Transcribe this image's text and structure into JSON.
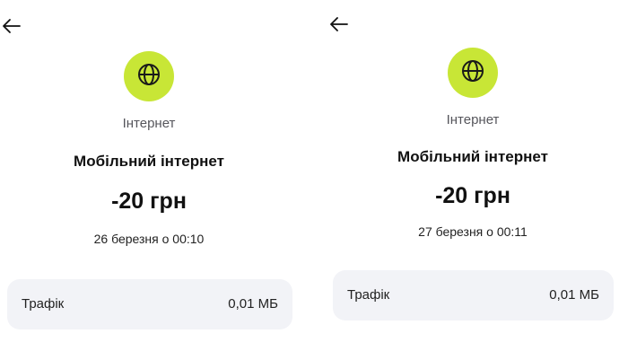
{
  "screens": [
    {
      "back_icon": "arrow-left-icon",
      "category_icon": "globe-icon",
      "category_color": "#c8e636",
      "category_label": "Інтернет",
      "title": "Мобільний інтернет",
      "amount": "-20 грн",
      "date": "26 березня о 00:10",
      "detail": {
        "label": "Трафік",
        "value": "0,01 МБ"
      }
    },
    {
      "back_icon": "arrow-left-icon",
      "category_icon": "globe-icon",
      "category_color": "#c8e636",
      "category_label": "Інтернет",
      "title": "Мобільний інтернет",
      "amount": "-20 грн",
      "date": "27 березня о 00:11",
      "detail": {
        "label": "Трафік",
        "value": "0,01 МБ"
      }
    }
  ]
}
